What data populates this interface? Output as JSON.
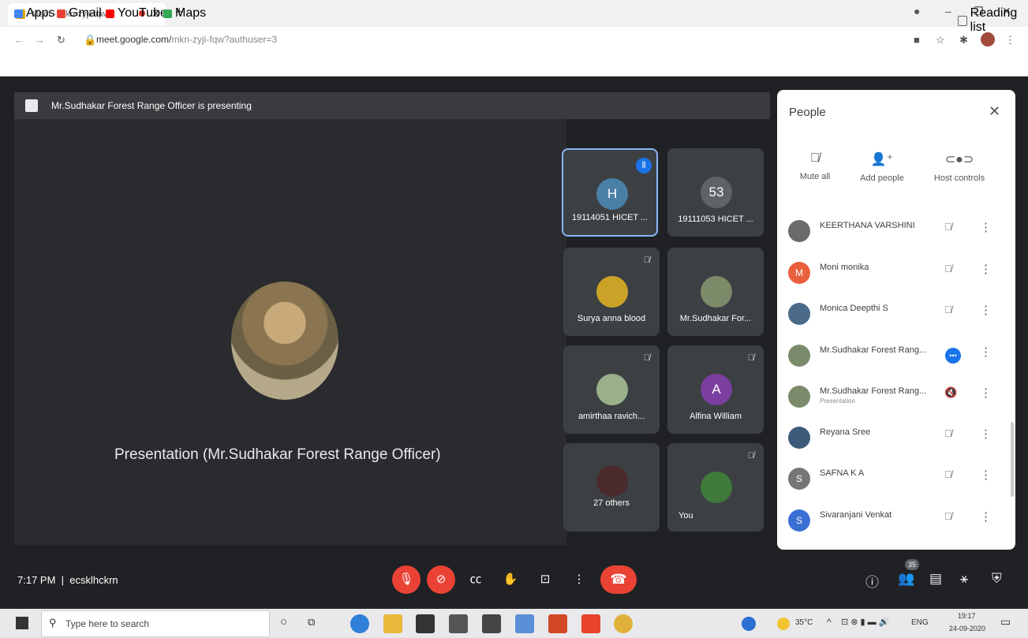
{
  "browser": {
    "tab_title": "Meet - mkn-zyji-fqw",
    "new_tab_symbol": "+",
    "url_host": "meet.google.com/",
    "url_path": "mkn-zyji-fqw?authuser=3",
    "bookmarks": [
      "Apps",
      "Gmail",
      "YouTube",
      "Maps"
    ],
    "reading_list": "Reading list"
  },
  "meet": {
    "presenting_banner": "Mr.Sudhakar Forest Range Officer is presenting",
    "main_caption": "Presentation (Mr.Sudhakar Forest Range Officer)",
    "tiles": [
      {
        "name": "19114051 HICET ...",
        "initial": "H",
        "color": "#4a7fa6"
      },
      {
        "name": "19111053 HICET ...",
        "initial": "53",
        "color": "#5f6368"
      },
      {
        "name": "Surya anna blood",
        "initial": "",
        "color": "#c9a227"
      },
      {
        "name": "Mr.Sudhakar For...",
        "initial": "",
        "color": "#7c8a6a"
      },
      {
        "name": "amirthaa ravich...",
        "initial": "",
        "color": "#9ab08a"
      },
      {
        "name": "Alfina William",
        "initial": "A",
        "color": "#7b3fa0"
      },
      {
        "name": "27 others",
        "initial": "",
        "color": "#3c4043"
      },
      {
        "name": "You",
        "initial": "",
        "color": "#3f7a3a"
      }
    ],
    "time": "7:17 PM",
    "meeting_code": "ecsklhckrn",
    "participant_count": "35"
  },
  "people": {
    "title": "People",
    "actions": [
      "Mute all",
      "Add people",
      "Host controls"
    ],
    "list": [
      {
        "name": "KEERTHANA VARSHINI",
        "initial": "",
        "color": "#6b6b6b",
        "sub": ""
      },
      {
        "name": "Moni monika",
        "initial": "M",
        "color": "#e8603c",
        "sub": ""
      },
      {
        "name": "Monica Deepthi S",
        "initial": "",
        "color": "#4b6a8a",
        "sub": ""
      },
      {
        "name": "Mr.Sudhakar Forest Rang...",
        "initial": "",
        "color": "#7a8a6a",
        "sub": ""
      },
      {
        "name": "Mr.Sudhakar Forest Rang...",
        "initial": "",
        "color": "#7a8a6a",
        "sub": "Presentation"
      },
      {
        "name": "Reyana Sree",
        "initial": "",
        "color": "#3d5a7a",
        "sub": ""
      },
      {
        "name": "SAFNA K A",
        "initial": "S",
        "color": "#757575",
        "sub": ""
      },
      {
        "name": "Sivaranjani Venkat",
        "initial": "S",
        "color": "#3b6fd4",
        "sub": ""
      }
    ]
  },
  "taskbar": {
    "search_placeholder": "Type here to search",
    "temperature": "35°C",
    "language": "ENG",
    "clock_time": "19:17",
    "clock_date": "24-09-2020"
  }
}
